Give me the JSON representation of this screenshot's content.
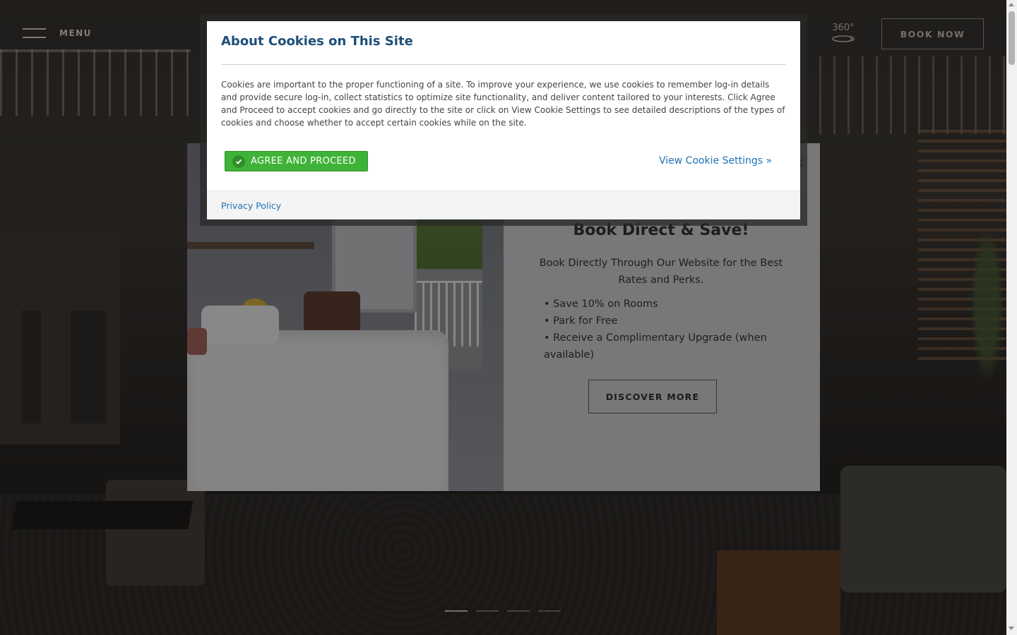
{
  "header": {
    "menu_label": "MENU",
    "tour_label": "360°",
    "book_now_label": "BOOK NOW"
  },
  "slider": {
    "dot_count": 4,
    "active_index": 0
  },
  "promo": {
    "title": "Book Direct & Save!",
    "subtitle": "Book Directly Through Our Website for the Best Rates and Perks.",
    "perks": [
      "Save 10% on Rooms",
      "Park for Free",
      "Receive a Complimentary Upgrade (when available)"
    ],
    "cta_label": "DISCOVER MORE",
    "close_icon": "close-icon"
  },
  "cookie_dialog": {
    "title": "About Cookies on This Site",
    "body": "Cookies are important to the proper functioning of a site. To improve your experience, we use cookies to remember log-in details and provide secure log-in, collect statistics to optimize site functionality, and deliver content tailored to your interests. Click Agree and Proceed to accept cookies and go directly to the site or click on View Cookie Settings to see detailed descriptions of the types of cookies and choose whether to accept certain cookies while on the site.",
    "agree_label": "AGREE AND PROCEED",
    "settings_label": "View Cookie Settings »",
    "privacy_label": "Privacy Policy",
    "colors": {
      "title": "#1d4e7a",
      "agree": "#3fb338",
      "link": "#1f73b7"
    }
  }
}
